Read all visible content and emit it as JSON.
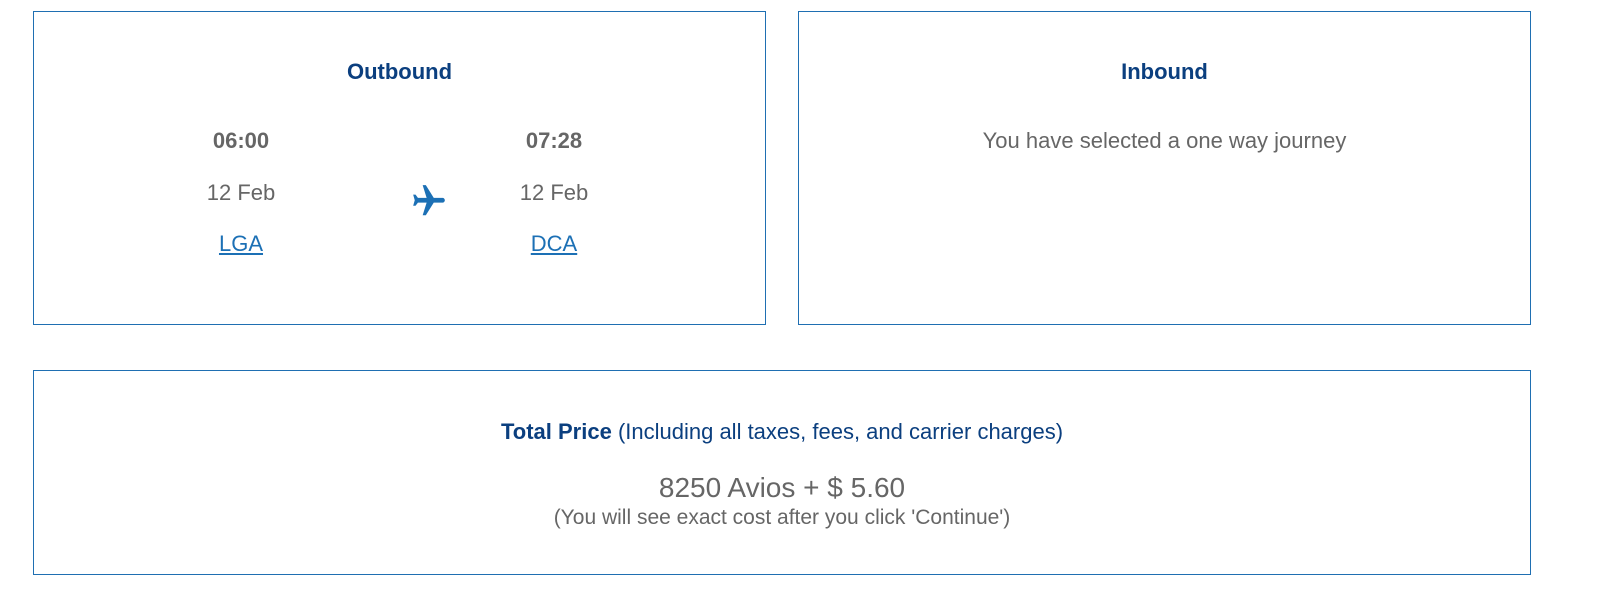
{
  "outbound": {
    "title": "Outbound",
    "departure": {
      "time": "06:00",
      "date": "12 Feb",
      "airport": "LGA"
    },
    "arrival": {
      "time": "07:28",
      "date": "12 Feb",
      "airport": "DCA"
    },
    "icon": "plane-icon"
  },
  "inbound": {
    "title": "Inbound",
    "message": "You have selected a one way journey"
  },
  "price": {
    "label": "Total Price",
    "qualifier": "(Including all taxes, fees, and carrier charges)",
    "amount": "8250 Avios + $ 5.60",
    "note": "(You will see exact cost after you click 'Continue')"
  },
  "colors": {
    "border": "#1f6fb2",
    "heading": "#0b3f7f",
    "link": "#1c70b5",
    "text": "#666666"
  }
}
